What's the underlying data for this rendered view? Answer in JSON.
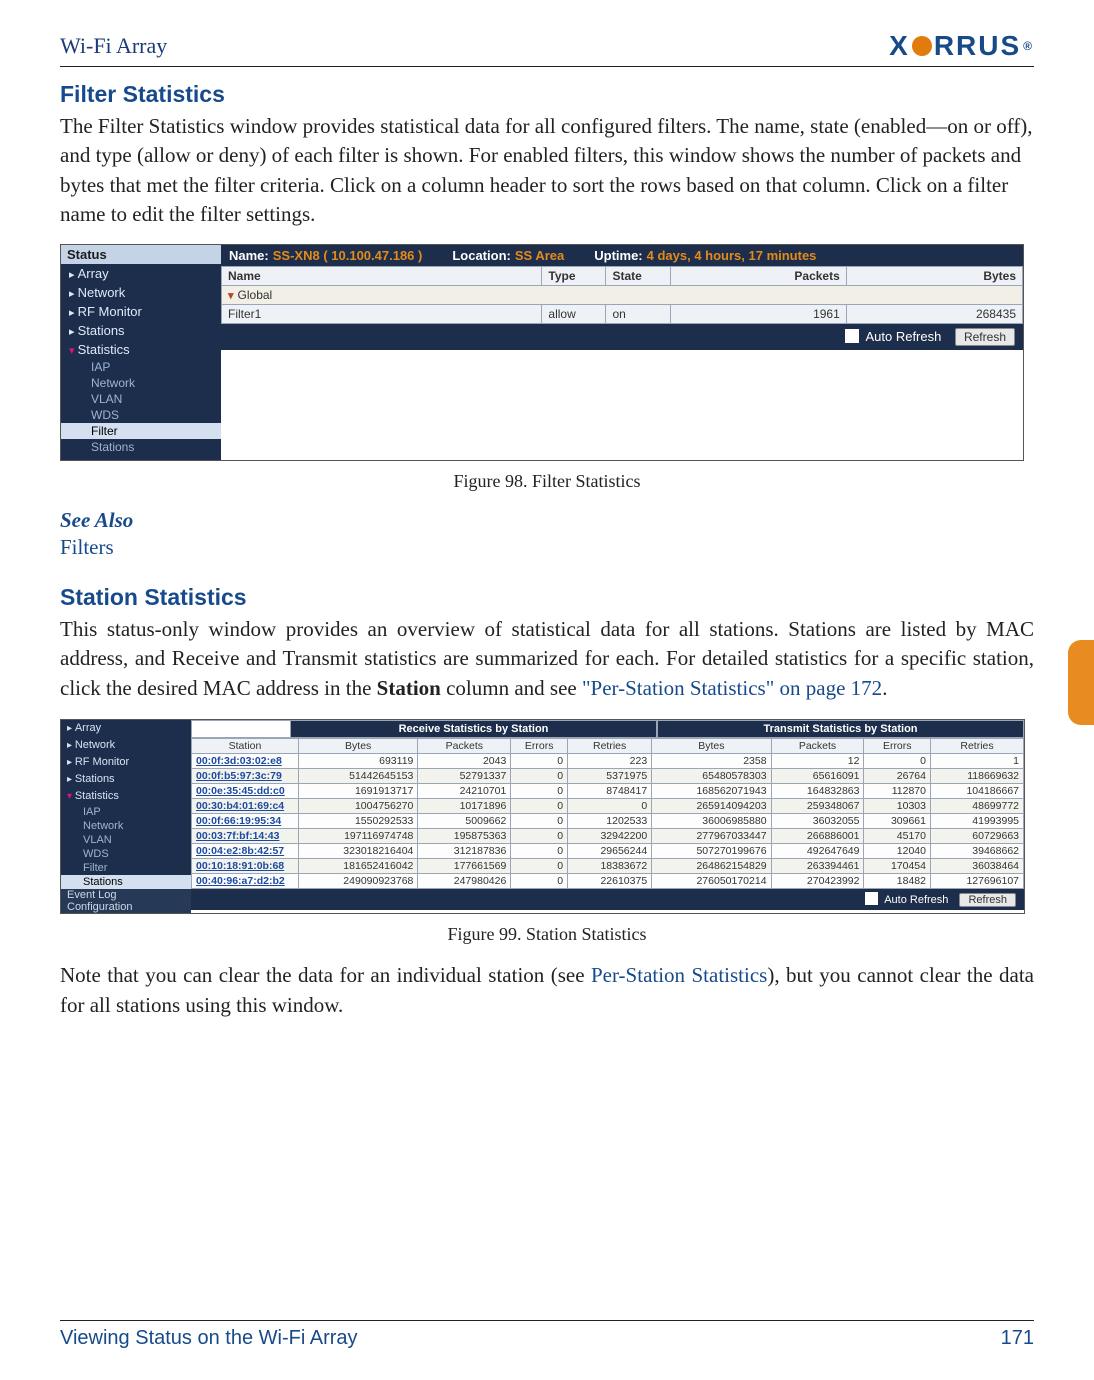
{
  "header": {
    "title": "Wi-Fi Array",
    "logo_text": "X RRUS"
  },
  "section1": {
    "heading": "Filter Statistics",
    "para": "The Filter Statistics window provides statistical data for all configured filters. The name, state (enabled—on or off), and type (allow or deny) of each filter is shown. For enabled filters, this window shows the number of packets and bytes that met the filter criteria. Click on a column header to sort the rows based on that column. Click on a filter name to edit the filter settings."
  },
  "fig98": {
    "caption": "Figure 98. Filter Statistics",
    "sidebar": {
      "head": "Status",
      "items": [
        "Array",
        "Network",
        "RF Monitor",
        "Stations",
        "Statistics"
      ],
      "subs": [
        "IAP",
        "Network",
        "VLAN",
        "WDS",
        "Filter",
        "Stations"
      ]
    },
    "title": {
      "name_label": "Name:",
      "name_val": "SS-XN8  ( 10.100.47.186 )",
      "loc_label": "Location:",
      "loc_val": "SS Area",
      "up_label": "Uptime:",
      "up_val": "4 days, 4 hours, 17 minutes"
    },
    "columns": [
      "Name",
      "Type",
      "State",
      "Packets",
      "Bytes"
    ],
    "global_label": "Global",
    "row": {
      "name": "Filter1",
      "type": "allow",
      "state": "on",
      "packets": "1961",
      "bytes": "268435"
    },
    "auto_refresh": "Auto Refresh",
    "refresh_btn": "Refresh"
  },
  "see_also": {
    "label": "See Also",
    "link": "Filters"
  },
  "section2": {
    "heading": "Station Statistics",
    "para_a": "This status-only window provides an overview of statistical data for all stations. Stations are listed by MAC address, and Receive and Transmit statistics are summarized for each. For detailed statistics for a specific station, click the desired MAC address in the ",
    "para_b_bold": "Station",
    "para_c": " column and see ",
    "para_link": "\"Per-Station Statistics\" on page 172",
    "para_d": "."
  },
  "fig99": {
    "caption": "Figure 99. Station Statistics",
    "sidebar": {
      "items": [
        "Array",
        "Network",
        "RF Monitor",
        "Stations",
        "Statistics"
      ],
      "subs": [
        "IAP",
        "Network",
        "VLAN",
        "WDS",
        "Filter",
        "Stations"
      ],
      "extra": [
        "Event Log",
        "Configuration"
      ]
    },
    "hdr_rx": "Receive Statistics by Station",
    "hdr_tx": "Transmit Statistics by Station",
    "columns": [
      "Station",
      "Bytes",
      "Packets",
      "Errors",
      "Retries",
      "Bytes",
      "Packets",
      "Errors",
      "Retries"
    ],
    "rows": [
      {
        "mac": "00:0f:3d:03:02:e8",
        "c": [
          "693119",
          "2043",
          "0",
          "223",
          "2358",
          "12",
          "0",
          "1"
        ]
      },
      {
        "mac": "00:0f:b5:97:3c:79",
        "c": [
          "51442645153",
          "52791337",
          "0",
          "5371975",
          "65480578303",
          "65616091",
          "26764",
          "118669632"
        ]
      },
      {
        "mac": "00:0e:35:45:dd:c0",
        "c": [
          "1691913717",
          "24210701",
          "0",
          "8748417",
          "168562071943",
          "164832863",
          "112870",
          "104186667"
        ]
      },
      {
        "mac": "00:30:b4:01:69:c4",
        "c": [
          "1004756270",
          "10171896",
          "0",
          "0",
          "265914094203",
          "259348067",
          "10303",
          "48699772"
        ]
      },
      {
        "mac": "00:0f:66:19:95:34",
        "c": [
          "1550292533",
          "5009662",
          "0",
          "1202533",
          "36006985880",
          "36032055",
          "309661",
          "41993995"
        ]
      },
      {
        "mac": "00:03:7f:bf:14:43",
        "c": [
          "197116974748",
          "195875363",
          "0",
          "32942200",
          "277967033447",
          "266886001",
          "45170",
          "60729663"
        ]
      },
      {
        "mac": "00:04:e2:8b:42:57",
        "c": [
          "323018216404",
          "312187836",
          "0",
          "29656244",
          "507270199676",
          "492647649",
          "12040",
          "39468662"
        ]
      },
      {
        "mac": "00:10:18:91:0b:68",
        "c": [
          "181652416042",
          "177661569",
          "0",
          "18383672",
          "264862154829",
          "263394461",
          "170454",
          "36038464"
        ]
      },
      {
        "mac": "00:40:96:a7:d2:b2",
        "c": [
          "249090923768",
          "247980426",
          "0",
          "22610375",
          "276050170214",
          "270423992",
          "18482",
          "127696107"
        ]
      }
    ],
    "auto_refresh": "Auto Refresh",
    "refresh_btn": "Refresh"
  },
  "note": {
    "a": "Note that you can clear the data for an individual station (see ",
    "link": "Per-Station Statistics",
    "b": "), but you cannot clear the data for all stations using this window."
  },
  "footer": {
    "left": "Viewing Status on the Wi-Fi Array",
    "right": "171"
  }
}
